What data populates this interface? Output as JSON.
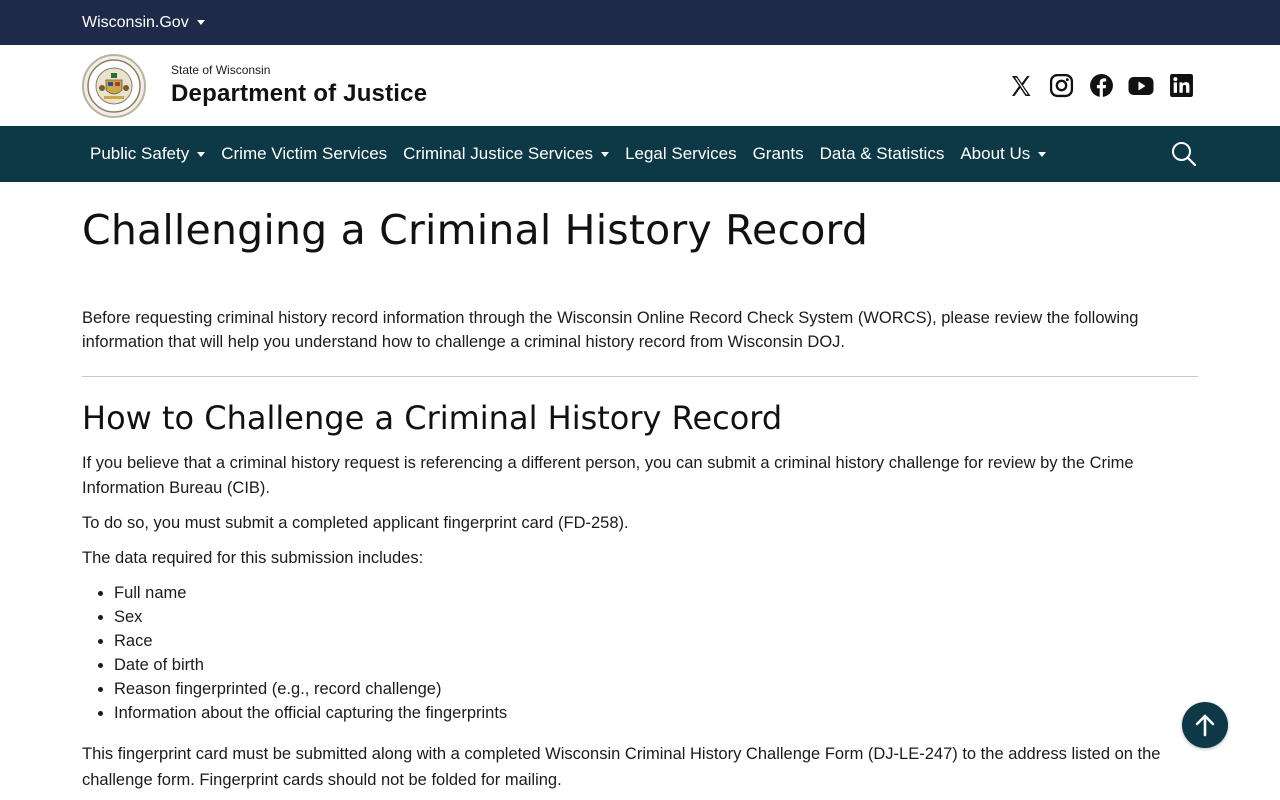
{
  "topbar": {
    "link_label": "Wisconsin.Gov"
  },
  "header": {
    "state_label": "State of Wisconsin",
    "agency_name": "Department of Justice"
  },
  "nav": {
    "items": [
      {
        "label": "Public Safety",
        "dropdown": true
      },
      {
        "label": "Crime Victim Services",
        "dropdown": false
      },
      {
        "label": "Criminal Justice Services",
        "dropdown": true
      },
      {
        "label": "Legal Services",
        "dropdown": false
      },
      {
        "label": "Grants",
        "dropdown": false
      },
      {
        "label": "Data & Statistics",
        "dropdown": false
      },
      {
        "label": "About Us",
        "dropdown": true
      }
    ]
  },
  "social": [
    "x-icon",
    "instagram-icon",
    "facebook-icon",
    "youtube-icon",
    "linkedin-icon"
  ],
  "main": {
    "title": "Challenging a Criminal History Record",
    "intro": "Before requesting criminal history record information through the Wisconsin Online Record Check System (WORCS), please review the following information that will help you understand how to challenge a criminal history record from Wisconsin DOJ.",
    "section_title": "How to Challenge a Criminal History Record",
    "para1": "If you believe that a criminal history request is referencing a different person, you can submit a criminal history challenge for review by the Crime Information Bureau (CIB).",
    "para2": "To do so, you must submit a completed applicant fingerprint card (FD-258).",
    "para3": "The data required for this submission includes:",
    "list": [
      "Full name",
      "Sex",
      "Race",
      "Date of birth",
      "Reason fingerprinted (e.g., record challenge)",
      "Information about the official capturing the fingerprints"
    ],
    "para4": "This fingerprint card must be submitted along with a completed Wisconsin Criminal History Challenge Form (DJ-LE-247) to the address listed on the challenge form. Fingerprint cards should not be folded for mailing."
  },
  "colors": {
    "topbar": "#1f2a4a",
    "nav": "#0c3945",
    "back_to_top": "#0c3945"
  }
}
